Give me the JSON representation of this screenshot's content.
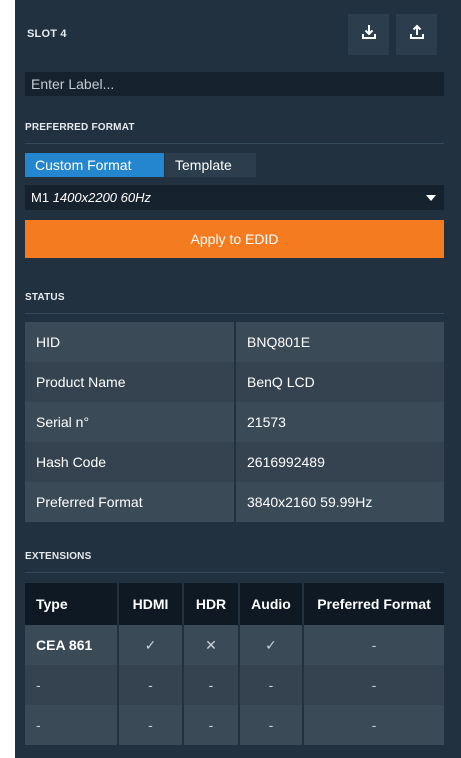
{
  "slot": {
    "title": "SLOT 4"
  },
  "toolbar": {
    "download_icon": "download-icon",
    "upload_icon": "upload-icon"
  },
  "label_input": {
    "placeholder": "Enter Label...",
    "value": ""
  },
  "preferred_format": {
    "title": "PREFERRED FORMAT",
    "tabs": [
      {
        "label": "Custom Format",
        "active": true
      },
      {
        "label": "Template",
        "active": false
      }
    ],
    "selected": {
      "prefix": "M1",
      "format": "1400x2200 60Hz"
    },
    "apply_label": "Apply to EDID"
  },
  "status": {
    "title": "STATUS",
    "rows": [
      {
        "key": "HID",
        "value": "BNQ801E"
      },
      {
        "key": "Product Name",
        "value": "BenQ LCD"
      },
      {
        "key": "Serial n°",
        "value": "21573"
      },
      {
        "key": "Hash Code",
        "value": "2616992489"
      },
      {
        "key": "Preferred Format",
        "value": "3840x2160 59.99Hz"
      }
    ]
  },
  "extensions": {
    "title": "EXTENSIONS",
    "headers": [
      "Type",
      "HDMI",
      "HDR",
      "Audio",
      "Preferred Format"
    ],
    "rows": [
      [
        "CEA 861",
        "✓",
        "✕",
        "✓",
        "-"
      ],
      [
        "-",
        "-",
        "-",
        "-",
        "-"
      ],
      [
        "-",
        "-",
        "-",
        "-",
        "-"
      ]
    ]
  },
  "colors": {
    "panel_bg": "#22313f",
    "accent_blue": "#2586d0",
    "accent_orange": "#f47b20",
    "check_green": "#2fc36a",
    "cross_red": "#e8424a"
  }
}
